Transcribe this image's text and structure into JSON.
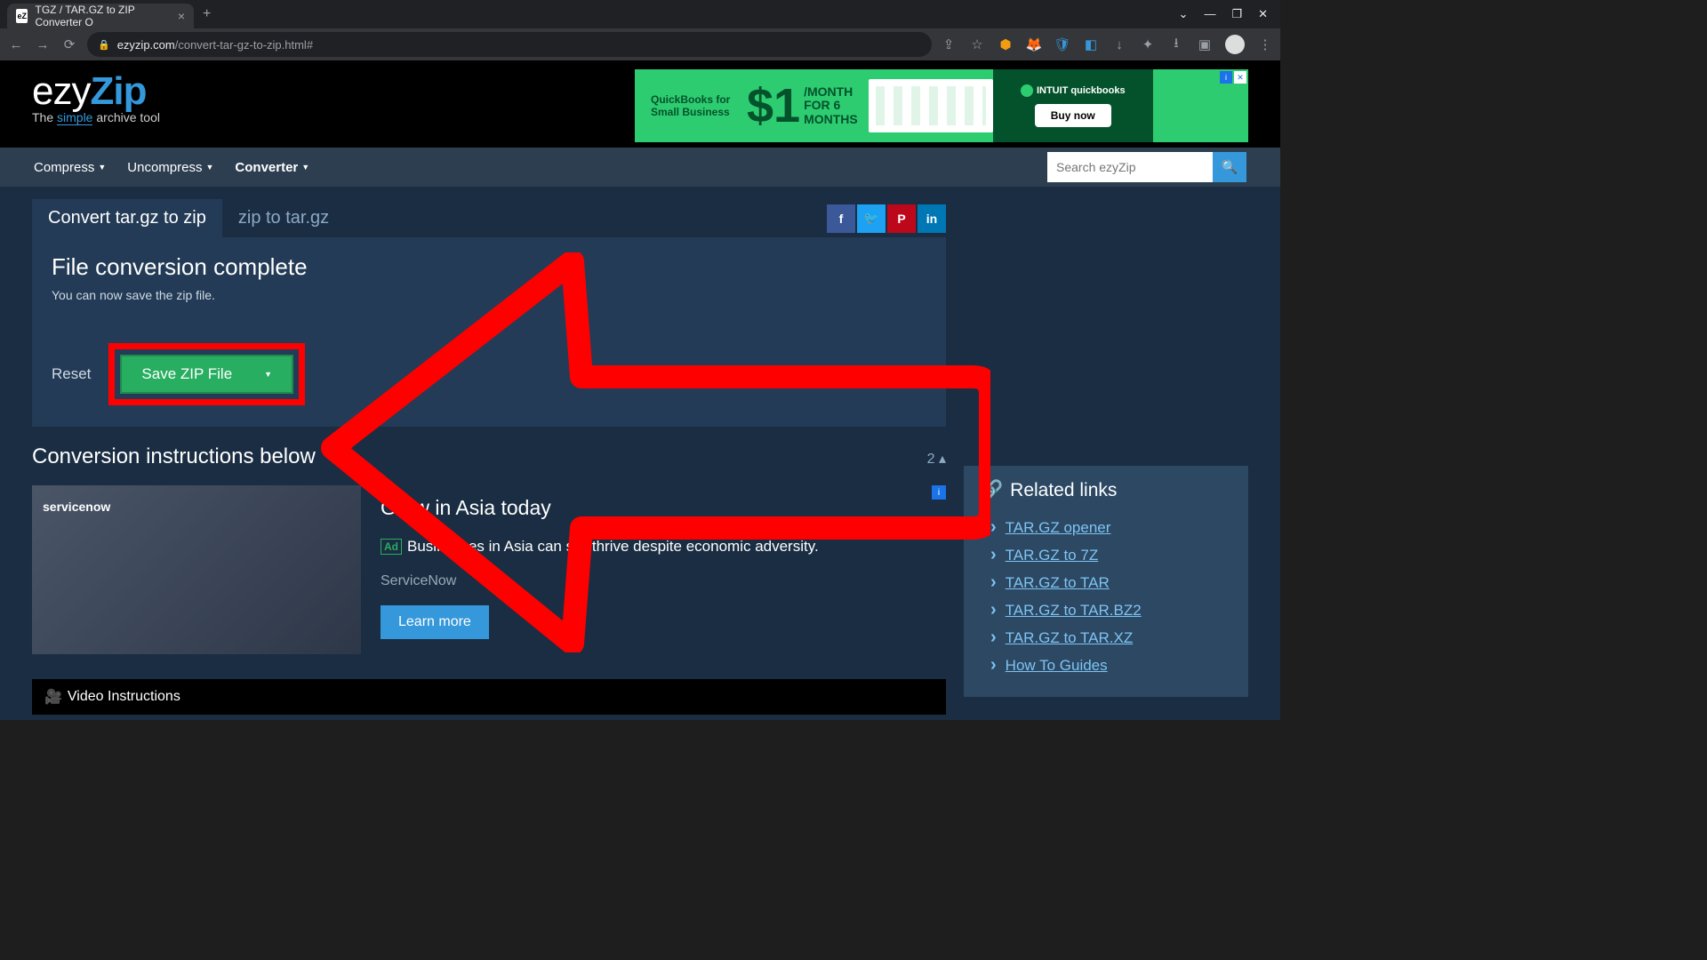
{
  "browser": {
    "tab_title": "TGZ / TAR.GZ to ZIP Converter O",
    "url_domain": "ezyzip.com",
    "url_path": "/convert-tar-gz-to-zip.html#"
  },
  "logo": {
    "part1": "ezy",
    "part2": "Zip",
    "sub_pre": "The ",
    "sub_simple": "simple",
    "sub_post": " archive tool"
  },
  "topAd": {
    "left": "QuickBooks for Small Business",
    "dollar": "$1",
    "month1": "/MONTH",
    "month2": "FOR 6",
    "month3": "MONTHS",
    "brand": "INTUIT quickbooks",
    "cta": "Buy now"
  },
  "nav": {
    "items": [
      "Compress",
      "Uncompress",
      "Converter"
    ],
    "search_placeholder": "Search ezyZip"
  },
  "tabs": {
    "active": "Convert tar.gz to zip",
    "other": "zip to tar.gz"
  },
  "status": {
    "title": "File conversion complete",
    "sub": "You can now save the zip file."
  },
  "buttons": {
    "reset": "Reset",
    "save": "Save ZIP File"
  },
  "instructions_title": "Conversion instructions below",
  "topright_num": "2",
  "ad2": {
    "logo": "servicenow",
    "title": "Grow in Asia today",
    "line": "Businesses in Asia can still thrive despite economic adversity.",
    "brand": "ServiceNow",
    "cta": "Learn more",
    "tag": "Ad"
  },
  "video_bar": "Video Instructions",
  "related": {
    "title": "Related links",
    "links": [
      "TAR.GZ opener",
      "TAR.GZ to 7Z",
      "TAR.GZ to TAR",
      "TAR.GZ to TAR.BZ2",
      "TAR.GZ to TAR.XZ",
      "How To Guides"
    ]
  }
}
